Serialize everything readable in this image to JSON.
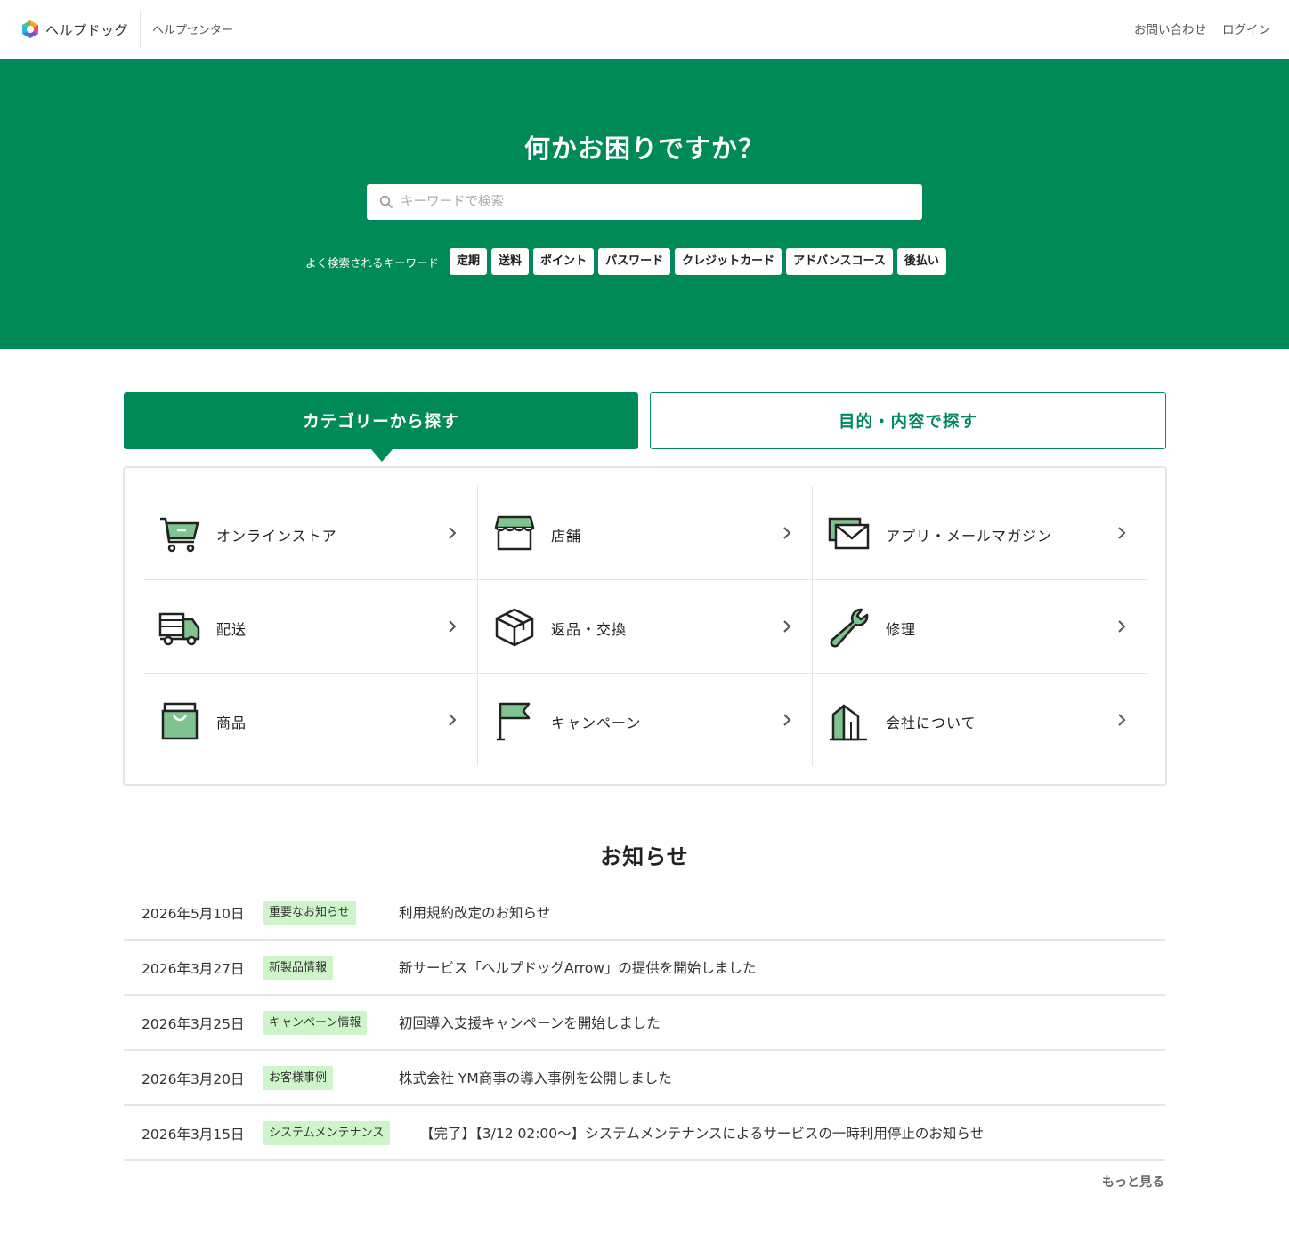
{
  "header": {
    "brand": "ヘルプドッグ",
    "helpcenter": "ヘルプセンター",
    "links": [
      "お問い合わせ",
      "ログイン"
    ]
  },
  "hero": {
    "title": "何かお困りですか？",
    "search_placeholder": "キーワードで検索",
    "keywords_label": "よく検索されるキーワード",
    "keywords": [
      "定期",
      "送料",
      "ポイント",
      "パスワード",
      "クレジットカード",
      "アドバンスコース",
      "後払い"
    ]
  },
  "tabs": {
    "active": "カテゴリーから探す",
    "inactive": "目的・内容で探す"
  },
  "categories": [
    {
      "label": "オンラインストア",
      "icon": "cart-icon"
    },
    {
      "label": "店舗",
      "icon": "store-icon"
    },
    {
      "label": "アプリ・メールマガジン",
      "icon": "mail-icon"
    },
    {
      "label": "配送",
      "icon": "truck-icon"
    },
    {
      "label": "返品・交換",
      "icon": "box-icon"
    },
    {
      "label": "修理",
      "icon": "wrench-icon"
    },
    {
      "label": "商品",
      "icon": "bag-icon"
    },
    {
      "label": "キャンペーン",
      "icon": "flag-icon"
    },
    {
      "label": "会社について",
      "icon": "building-icon"
    }
  ],
  "news": {
    "title": "お知らせ",
    "items": [
      {
        "date": "2026年5月10日",
        "badge": "重要なお知らせ",
        "text": "利用規約改定のお知らせ"
      },
      {
        "date": "2026年3月27日",
        "badge": "新製品情報",
        "text": "新サービス「ヘルプドッグArrow」の提供を開始しました"
      },
      {
        "date": "2026年3月25日",
        "badge": "キャンペーン情報",
        "text": "初回導入支援キャンペーンを開始しました"
      },
      {
        "date": "2026年3月20日",
        "badge": "お客様事例",
        "text": "株式会社 YM商事の導入事例を公開しました"
      },
      {
        "date": "2026年3月15日",
        "badge": "システムメンテナンス",
        "text": "【完了】【3/12 02:00〜】システムメンテナンスによるサービスの一時利用停止のお知らせ"
      }
    ],
    "more": "もっと見る"
  },
  "colors": {
    "brand_green": "#008a58",
    "badge_bg": "#cdf5c9",
    "icon_fill": "#7fc48f"
  }
}
